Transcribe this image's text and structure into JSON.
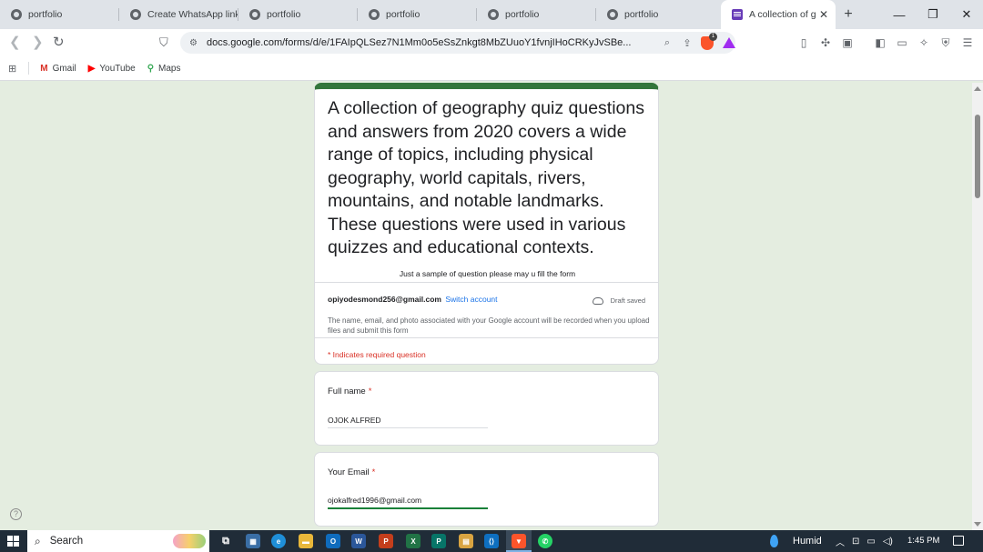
{
  "browser": {
    "tabs": [
      {
        "title": "portfolio",
        "icon": "globe-icon"
      },
      {
        "title": "Create WhatsApp link",
        "icon": "globe-icon"
      },
      {
        "title": "portfolio",
        "icon": "globe-icon"
      },
      {
        "title": "portfolio",
        "icon": "globe-icon"
      },
      {
        "title": "portfolio",
        "icon": "globe-icon"
      },
      {
        "title": "portfolio",
        "icon": "globe-icon"
      },
      {
        "title": "A collection of g",
        "icon": "google-forms-icon",
        "active": true
      }
    ],
    "url": "docs.google.com/forms/d/e/1FAIpQLSez7N1Mm0o5eSsZnkgt8MbZUuoY1fvnjIHoCRKyJvSBe...",
    "brave_badge": "1",
    "bookmarks": [
      {
        "label": "Gmail",
        "icon": "gmail-icon"
      },
      {
        "label": "YouTube",
        "icon": "youtube-icon"
      },
      {
        "label": "Maps",
        "icon": "maps-icon"
      }
    ]
  },
  "form": {
    "title": "A collection of geography quiz questions and answers from 2020 covers a wide range of topics, including physical geography, world capitals, rivers, mountains, and notable landmarks. These questions were used in various quizzes and educational contexts.",
    "description": "Just a sample of question please may u fill the form",
    "account_email": "opiyodesmond256@gmail.com",
    "switch_account": "Switch account",
    "draft_status": "Draft saved",
    "notice": "The name, email, and photo associated with your Google account will be recorded when you upload files and submit this form",
    "required_note": "* Indicates required question",
    "questions": [
      {
        "label": "Full name",
        "required_mark": "*",
        "value": "OJOK ALFRED"
      },
      {
        "label": "Your Email",
        "required_mark": "*",
        "value": "ojokalfred1996@gmail.com"
      }
    ],
    "accent_color": "#34763c",
    "background_color": "#e4ede0"
  },
  "taskbar": {
    "search_label": "Search",
    "weather": "Humid",
    "time": "1:45 PM"
  }
}
